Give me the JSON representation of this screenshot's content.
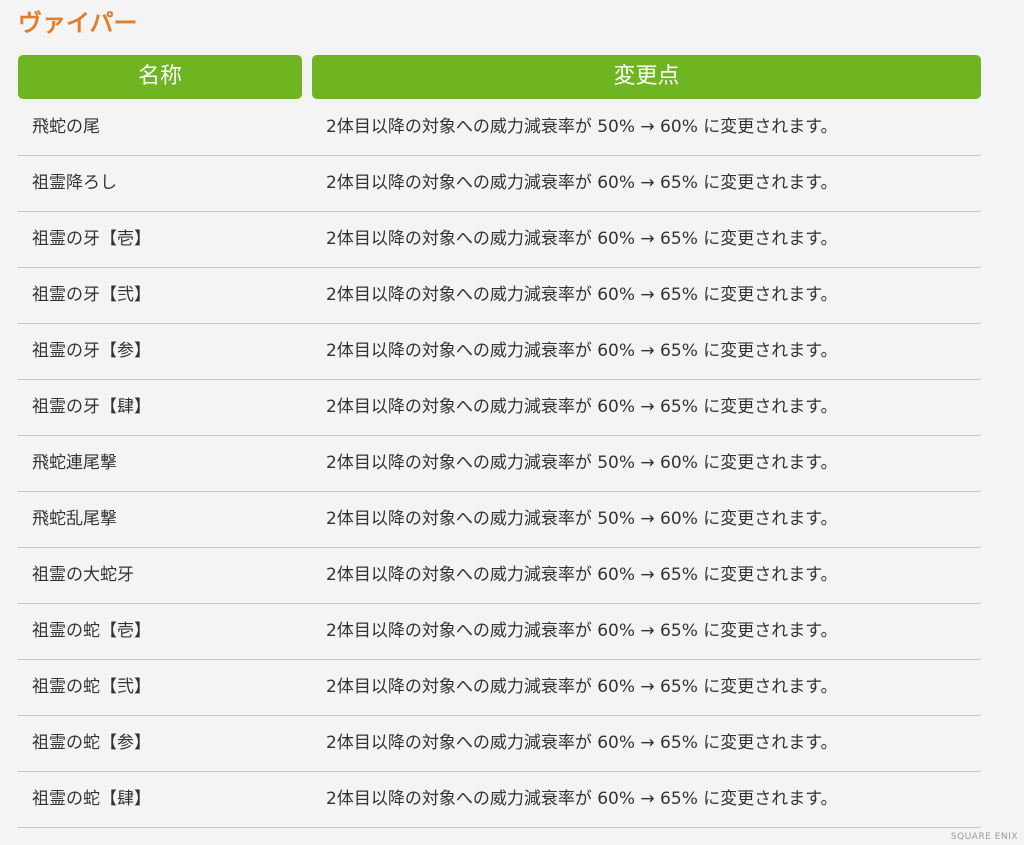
{
  "page": {
    "title": "ヴァイパー",
    "watermark": "SQUARE ENIX"
  },
  "table": {
    "headers": {
      "name": "名称",
      "change": "変更点"
    },
    "rows": [
      {
        "name": "飛蛇の尾",
        "change": "2体目以降の対象への威力減衰率が 50% → 60% に変更されます。"
      },
      {
        "name": "祖霊降ろし",
        "change": "2体目以降の対象への威力減衰率が 60% → 65% に変更されます。"
      },
      {
        "name": "祖霊の牙【壱】",
        "change": "2体目以降の対象への威力減衰率が 60% → 65% に変更されます。"
      },
      {
        "name": "祖霊の牙【弐】",
        "change": "2体目以降の対象への威力減衰率が 60% → 65% に変更されます。"
      },
      {
        "name": "祖霊の牙【参】",
        "change": "2体目以降の対象への威力減衰率が 60% → 65% に変更されます。"
      },
      {
        "name": "祖霊の牙【肆】",
        "change": "2体目以降の対象への威力減衰率が 60% → 65% に変更されます。"
      },
      {
        "name": "飛蛇連尾撃",
        "change": "2体目以降の対象への威力減衰率が 50% → 60% に変更されます。"
      },
      {
        "name": "飛蛇乱尾撃",
        "change": "2体目以降の対象への威力減衰率が 50% → 60% に変更されます。"
      },
      {
        "name": "祖霊の大蛇牙",
        "change": "2体目以降の対象への威力減衰率が 60% → 65% に変更されます。"
      },
      {
        "name": "祖霊の蛇【壱】",
        "change": "2体目以降の対象への威力減衰率が 60% → 65% に変更されます。"
      },
      {
        "name": "祖霊の蛇【弐】",
        "change": "2体目以降の対象への威力減衰率が 60% → 65% に変更されます。"
      },
      {
        "name": "祖霊の蛇【参】",
        "change": "2体目以降の対象への威力減衰率が 60% → 65% に変更されます。"
      },
      {
        "name": "祖霊の蛇【肆】",
        "change": "2体目以降の対象への威力減衰率が 60% → 65% に変更されます。"
      }
    ]
  },
  "colors": {
    "title": "#e07d2e",
    "header_bg": "#6fb421",
    "header_text": "#ffffff",
    "row_divider": "#c8c8c8",
    "background": "#f4f4f4"
  }
}
